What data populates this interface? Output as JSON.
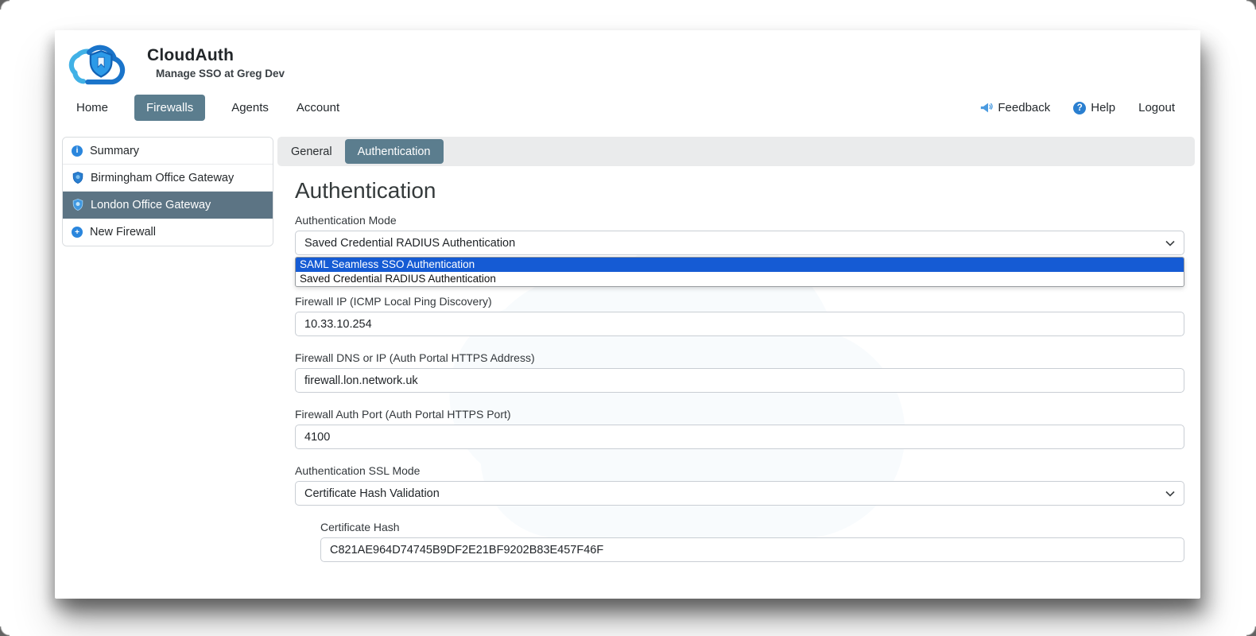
{
  "app": {
    "name": "CloudAuth",
    "tagline": "Manage SSO at Greg Dev"
  },
  "nav": {
    "items": [
      {
        "label": "Home",
        "active": false
      },
      {
        "label": "Firewalls",
        "active": true
      },
      {
        "label": "Agents",
        "active": false
      },
      {
        "label": "Account",
        "active": false
      }
    ],
    "feedback_label": "Feedback",
    "help_label": "Help",
    "help_glyph": "?",
    "logout_label": "Logout"
  },
  "sidebar": {
    "items": [
      {
        "label": "Summary",
        "icon": "info-icon",
        "selected": false,
        "glyph": "i"
      },
      {
        "label": "Birmingham Office Gateway",
        "icon": "shield-icon",
        "selected": false
      },
      {
        "label": "London Office Gateway",
        "icon": "shield-icon",
        "selected": true
      },
      {
        "label": "New Firewall",
        "icon": "plus-icon",
        "selected": false,
        "glyph": "+"
      }
    ]
  },
  "tabs": [
    {
      "label": "General",
      "active": false
    },
    {
      "label": "Authentication",
      "active": true
    }
  ],
  "page": {
    "heading": "Authentication"
  },
  "form": {
    "auth_mode": {
      "label": "Authentication Mode",
      "value": "Saved Credential RADIUS Authentication",
      "open": true,
      "options": [
        "SAML Seamless SSO Authentication",
        "Saved Credential RADIUS Authentication"
      ],
      "highlighted_option": "SAML Seamless SSO Authentication"
    },
    "firewall_ip": {
      "label": "Firewall IP (ICMP Local Ping Discovery)",
      "value": "10.33.10.254"
    },
    "firewall_dns": {
      "label": "Firewall DNS or IP (Auth Portal HTTPS Address)",
      "value": "firewall.lon.network.uk"
    },
    "auth_port": {
      "label": "Firewall Auth Port (Auth Portal HTTPS Port)",
      "value": "4100"
    },
    "ssl_mode": {
      "label": "Authentication SSL Mode",
      "value": "Certificate Hash Validation"
    },
    "cert_hash": {
      "label": "Certificate Hash",
      "value": "C821AE964D74745B9DF2E21BF9202B83E457F46F"
    }
  },
  "colors": {
    "active_pill": "#5b7d8e",
    "sidebar_selected": "#5c7484",
    "dropdown_highlight": "#155bd4",
    "icon_blue": "#2a7fd0",
    "logo_light_blue": "#41b1e6",
    "logo_dark_blue": "#1a74ca"
  }
}
